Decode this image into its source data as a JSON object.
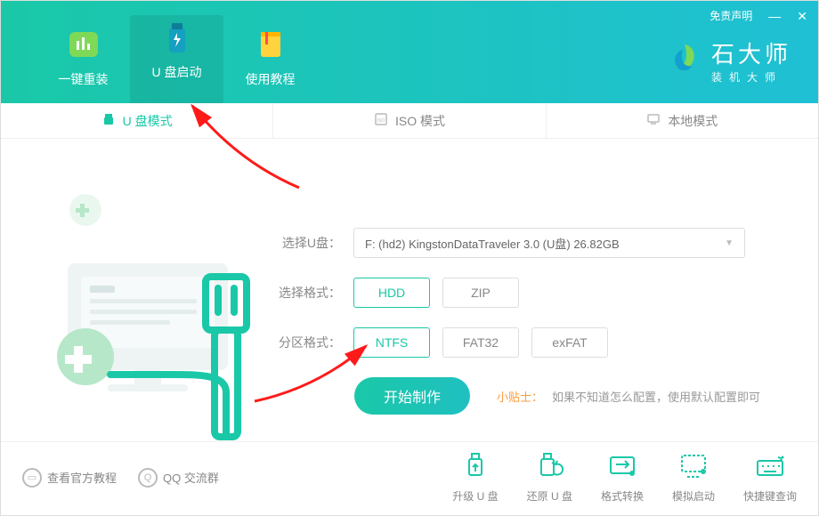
{
  "header": {
    "disclaimer": "免责声明",
    "tabs": [
      {
        "label": "一键重装"
      },
      {
        "label": "U 盘启动"
      },
      {
        "label": "使用教程"
      }
    ],
    "brand": {
      "title": "石大师",
      "subtitle": "装机大师"
    }
  },
  "mode_tabs": [
    {
      "label": "U 盘模式",
      "active": true
    },
    {
      "label": "ISO 模式",
      "active": false
    },
    {
      "label": "本地模式",
      "active": false
    }
  ],
  "form": {
    "udisk_label": "选择U盘：",
    "udisk_value": "F:  (hd2) KingstonDataTraveler 3.0 (U盘) 26.82GB",
    "format_label": "选择格式：",
    "format_options": [
      "HDD",
      "ZIP"
    ],
    "partition_label": "分区格式：",
    "partition_options": [
      "NTFS",
      "FAT32",
      "exFAT"
    ],
    "start_button": "开始制作",
    "tip_label": "小贴士：",
    "tip_text": "如果不知道怎么配置，使用默认配置即可"
  },
  "footer": {
    "left": [
      {
        "label": "查看官方教程"
      },
      {
        "label": "QQ 交流群"
      }
    ],
    "right": [
      {
        "label": "升级 U 盘"
      },
      {
        "label": "还原 U 盘"
      },
      {
        "label": "格式转换"
      },
      {
        "label": "模拟启动"
      },
      {
        "label": "快捷键查询"
      }
    ]
  }
}
